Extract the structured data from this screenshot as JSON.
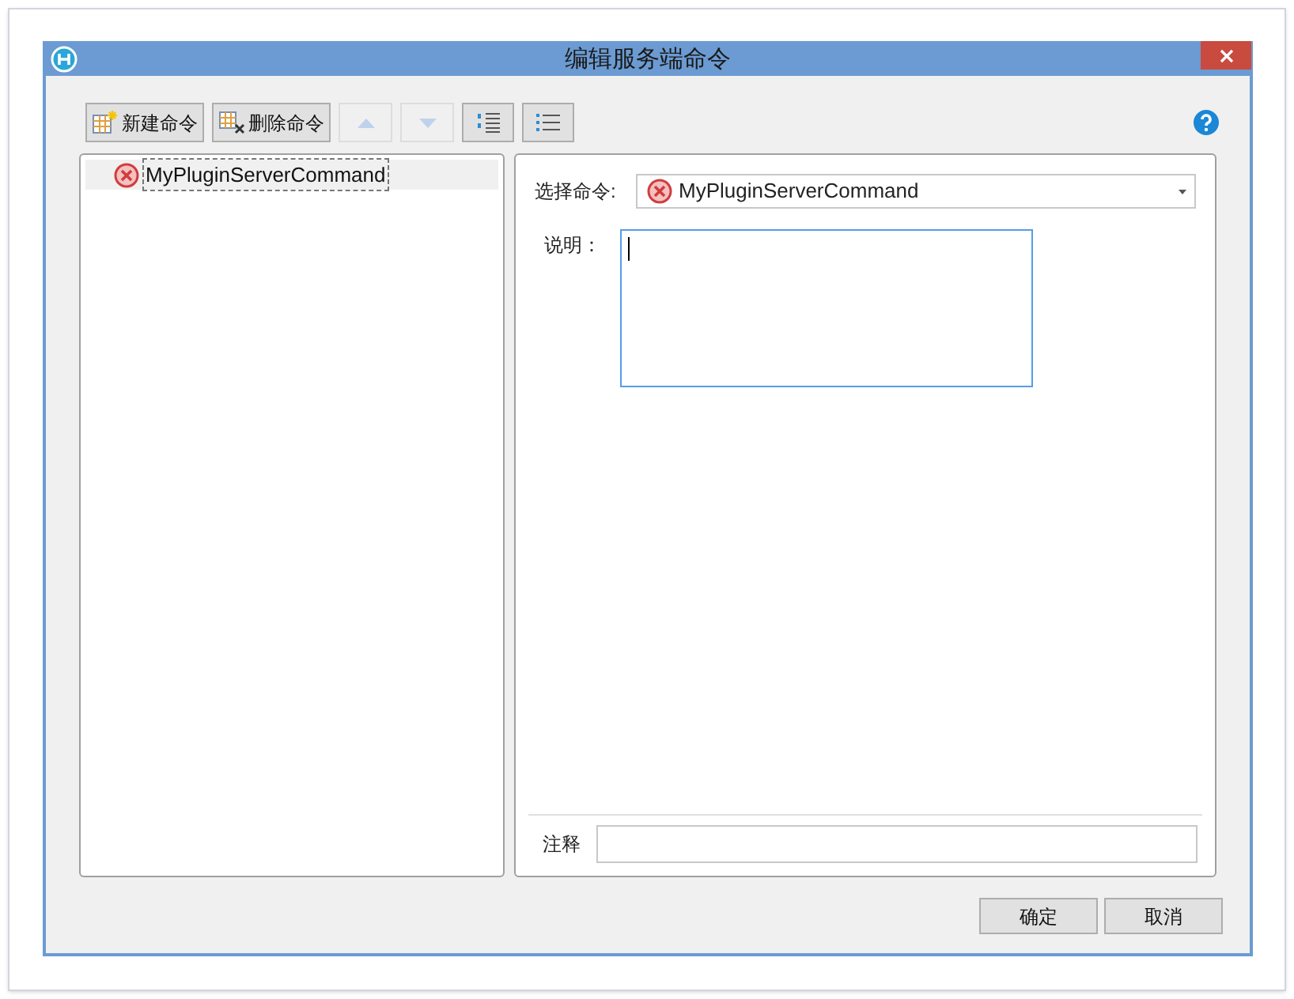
{
  "window": {
    "title": "编辑服务端命令"
  },
  "toolbar": [
    {
      "kind": "new",
      "label": "新建命令",
      "disabled": false
    },
    {
      "kind": "delete",
      "label": "删除命令",
      "disabled": false
    },
    {
      "kind": "up",
      "disabled": true
    },
    {
      "kind": "down",
      "disabled": true
    },
    {
      "kind": "indent",
      "disabled": false
    },
    {
      "kind": "outdent",
      "disabled": false
    }
  ],
  "command_list": [
    {
      "label": "MyPluginServerCommand",
      "selected": true
    }
  ],
  "form": {
    "select_label": "选择命令:",
    "select_value": "MyPluginServerCommand",
    "description_label": "说明：",
    "comment_label": "注释"
  },
  "buttons": [
    "确定",
    "取消"
  ]
}
